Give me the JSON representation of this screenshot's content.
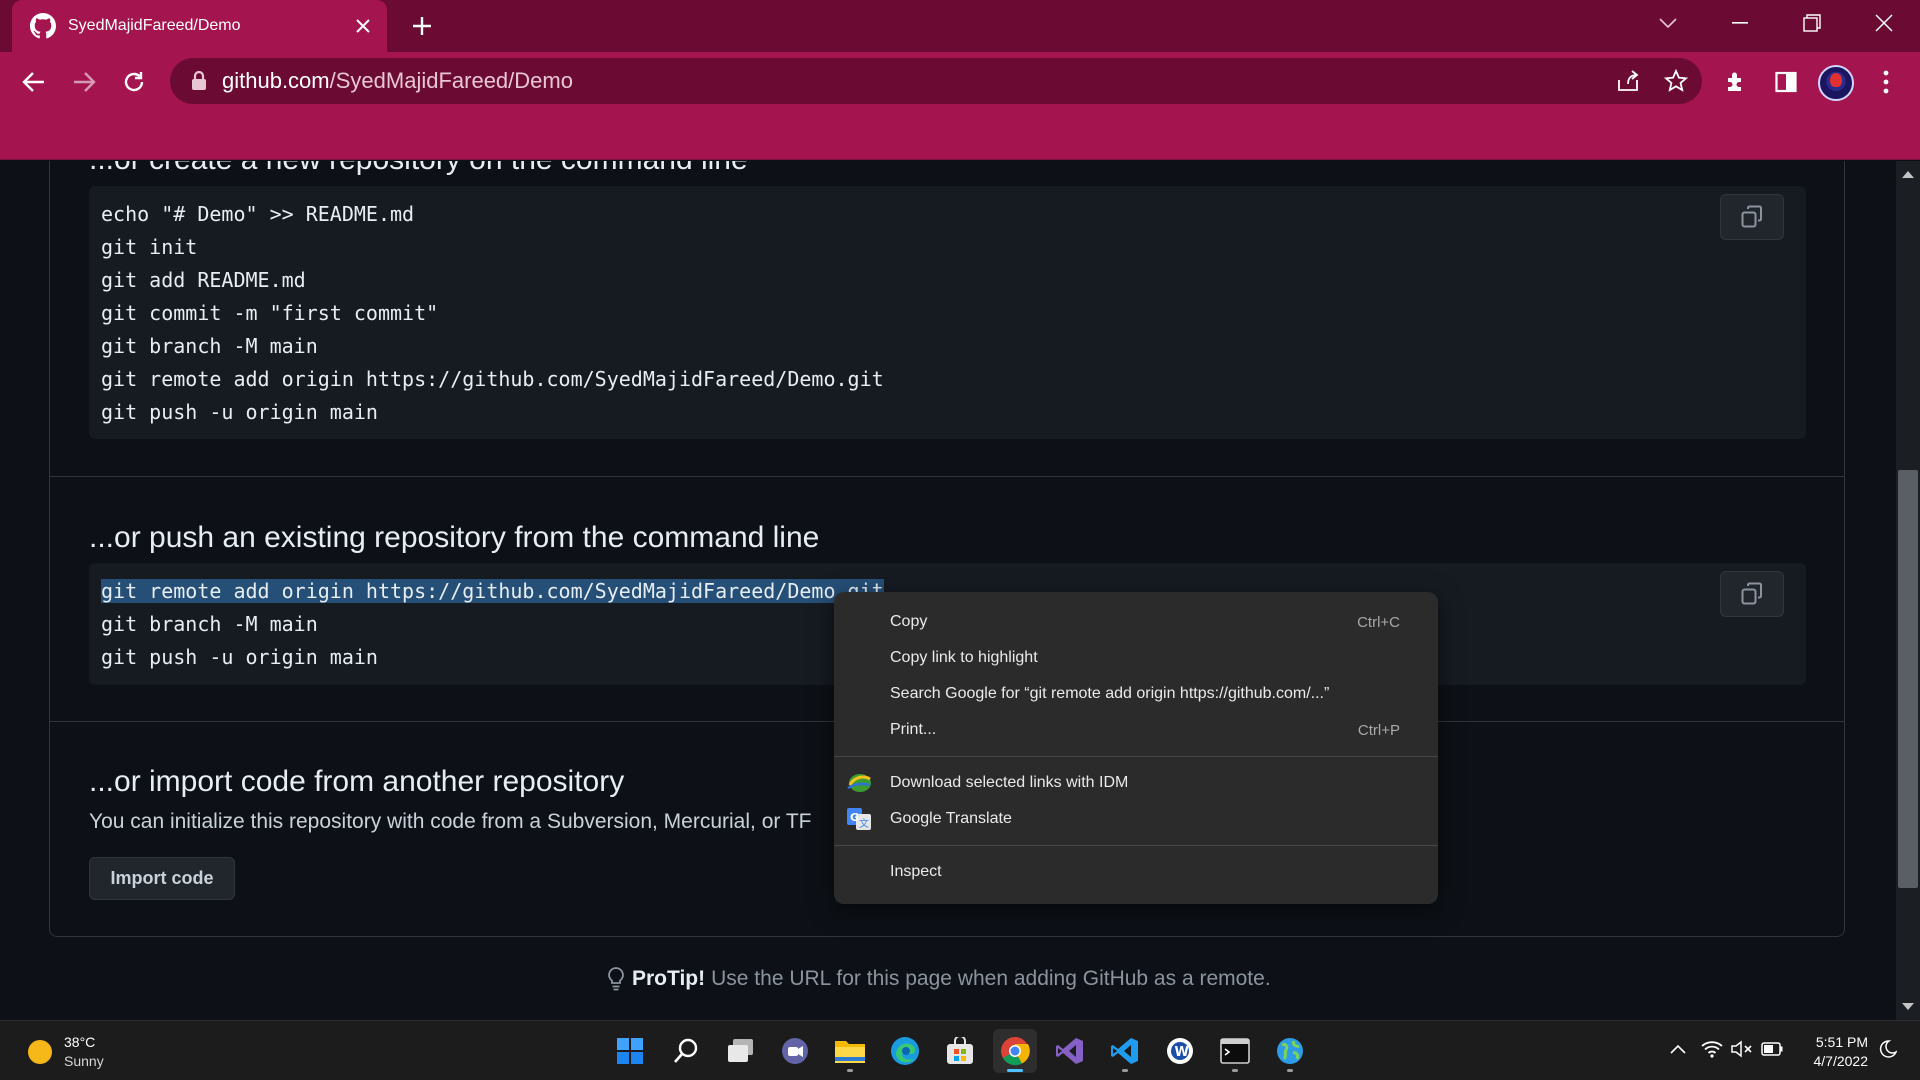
{
  "browser": {
    "tab_title": "SyedMajidFareed/Demo",
    "url_host": "github.com",
    "url_path": "/SyedMajidFareed/Demo"
  },
  "page": {
    "section1_title": "...or create a new repository on the command line",
    "section1_code": [
      "echo \"# Demo\" >> README.md",
      "git init",
      "git add README.md",
      "git commit -m \"first commit\"",
      "git branch -M main",
      "git remote add origin https://github.com/SyedMajidFareed/Demo.git",
      "git push -u origin main"
    ],
    "section2_title": "...or push an existing repository from the command line",
    "section2_code": [
      "git remote add origin https://github.com/SyedMajidFareed/Demo.git",
      "git branch -M main",
      "git push -u origin main"
    ],
    "section3_title": "...or import code from another repository",
    "section3_desc": "You can initialize this repository with code from a Subversion, Mercurial, or TF",
    "import_button": "Import code",
    "protip_label": "ProTip!",
    "protip_text": "Use the URL for this page when adding GitHub as a remote."
  },
  "context_menu": {
    "copy": "Copy",
    "copy_shortcut": "Ctrl+C",
    "copy_link": "Copy link to highlight",
    "search_google": "Search Google for “git remote add origin https://github.com/...”",
    "print": "Print...",
    "print_shortcut": "Ctrl+P",
    "idm": "Download selected links with IDM",
    "translate": "Google Translate",
    "inspect": "Inspect"
  },
  "taskbar": {
    "weather_temp": "38°C",
    "weather_desc": "Sunny",
    "time": "5:51 PM",
    "date": "4/7/2022"
  },
  "icons": [
    "github-icon",
    "close-icon",
    "plus-icon",
    "back-icon",
    "forward-icon",
    "reload-icon",
    "lock-icon",
    "share-icon",
    "star-icon",
    "extensions-icon",
    "side-panel-icon",
    "menu-icon",
    "copy-icon",
    "lightbulb-icon",
    "idm-icon",
    "google-translate-icon",
    "start-icon",
    "search-icon",
    "task-view-icon",
    "teams-icon",
    "file-explorer-icon",
    "edge-icon",
    "store-icon",
    "chrome-icon",
    "visual-studio-icon",
    "vscode-icon",
    "word-icon",
    "terminal-icon",
    "globe-icon",
    "wifi-icon",
    "volume-icon",
    "battery-icon"
  ],
  "colors": {
    "tab_bg": "#a4154f",
    "tabstrip_bg": "#6b0b34",
    "page_bg": "#0d1117",
    "code_bg": "#161b22",
    "selection": "#264f78"
  }
}
